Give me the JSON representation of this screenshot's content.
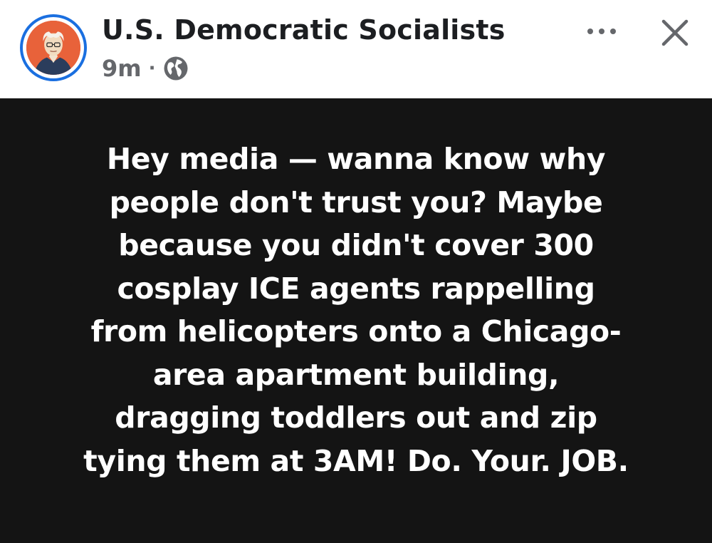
{
  "header": {
    "page_name": "U.S. Democratic Socialists",
    "timestamp": "9m",
    "separator": "·",
    "privacy_icon": "globe-icon",
    "more_icon": "more-horizontal-icon",
    "close_icon": "close-icon",
    "avatar": "profile-avatar"
  },
  "post": {
    "lines": [
      "Hey media — wanna know why",
      "people don't trust you? Maybe",
      "because you didn't cover 300",
      "cosplay ICE agents rappelling",
      "from helicopters onto a Chicago-",
      "area apartment building,",
      "dragging toddlers out and zip",
      "tying them at 3AM! Do. Your. JOB."
    ]
  },
  "colors": {
    "avatar_ring": "#1a6fe0",
    "post_background": "#141414",
    "post_text": "#ffffff",
    "meta_text": "#65676b"
  }
}
